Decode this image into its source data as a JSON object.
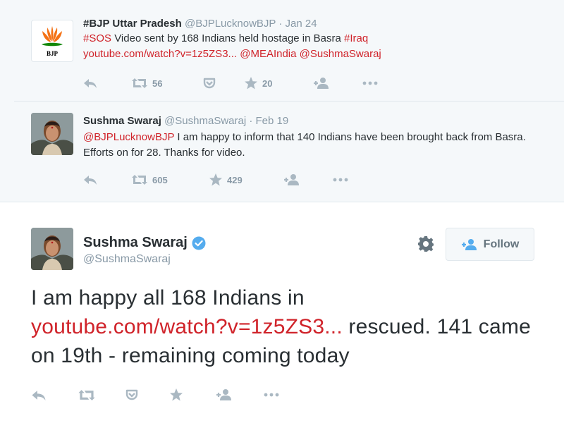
{
  "tweets": [
    {
      "name": "#BJP Uttar Pradesh",
      "handle": "@BJPLucknowBJP",
      "dot": "·",
      "date": "Jan 24",
      "avatar_label": "BJP",
      "text_parts": [
        "#SOS",
        " Video sent by 168 Indians held hostage in Basra ",
        "#Iraq",
        "youtube.com/watch?v=1z5ZS3...",
        " ",
        "@MEAIndia",
        " ",
        "@SushmaSwaraj"
      ],
      "retweets": "56",
      "favorites": "20"
    },
    {
      "name": "Sushma Swaraj",
      "handle": "@SushmaSwaraj",
      "dot": "·",
      "date": "Feb 19",
      "text_parts": [
        "@BJPLucknowBJP",
        "  I am happy to inform that 140 Indians have been brought back from Basra. Efforts on for 28. Thanks for video."
      ],
      "retweets": "605",
      "favorites": "429"
    }
  ],
  "main": {
    "name": "Sushma Swaraj",
    "handle": "@SushmaSwaraj",
    "follow_label": "Follow",
    "text_parts": [
      "I am happy all 168 Indians in ",
      "youtube.com/watch?v=1z5ZS3...",
      " rescued. 141 came on 19th - remaining coming today"
    ]
  },
  "icons": [
    "reply-icon",
    "retweet-icon",
    "pocket-icon",
    "favorite-icon",
    "follow-icon",
    "more-icon",
    "gear-icon",
    "verified-icon"
  ],
  "colors": {
    "link": "#d0232a",
    "icon_gray": "#aab8c2",
    "verified": "#55acee",
    "bjp_orange": "#f47216",
    "bjp_green": "#138808"
  }
}
